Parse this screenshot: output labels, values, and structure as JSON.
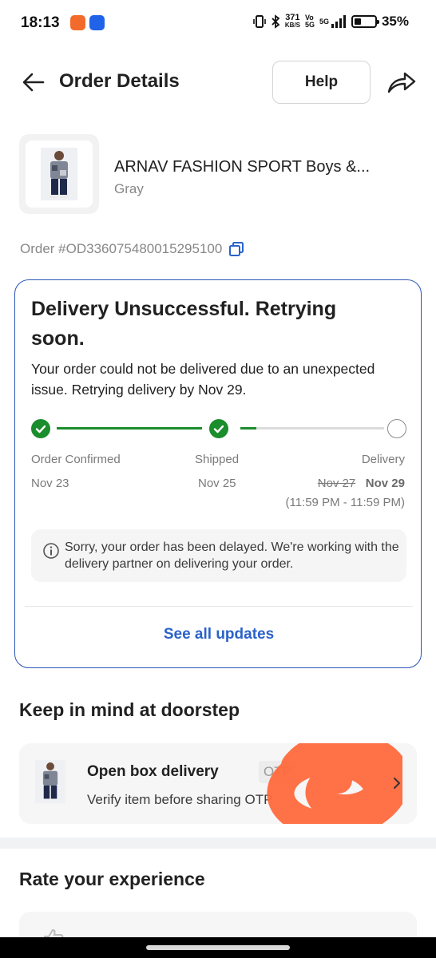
{
  "status_bar": {
    "time": "18:13",
    "net_speed": "371",
    "net_unit": "KB/S",
    "network_label": "5G",
    "battery": "35%"
  },
  "header": {
    "title": "Order Details",
    "help_label": "Help"
  },
  "product": {
    "name": "ARNAV FASHION SPORT Boys &...",
    "variant": "Gray"
  },
  "order": {
    "id": "Order #OD336075480015295100"
  },
  "status_card": {
    "title": "Delivery Unsuccessful. Retrying soon.",
    "description": "Your order could not be delivered due to an unexpected issue. Retrying delivery by Nov 29.",
    "steps": [
      {
        "label": "Order Confirmed",
        "date": "Nov 23",
        "state": "done"
      },
      {
        "label": "Shipped",
        "date": "Nov 25",
        "state": "done"
      },
      {
        "label": "Delivery",
        "old_date": "Nov 27",
        "date": "Nov 29",
        "time": "(11:59 PM - 11:59 PM)",
        "state": "pending"
      }
    ],
    "delay_message": "Sorry, your order has been delayed. We're working with the delivery partner on delivering your order.",
    "see_all_label": "See all updates"
  },
  "doorstep": {
    "section_title": "Keep in mind at doorstep",
    "title": "Open box delivery",
    "tag": "OTP",
    "subtitle": "Verify item before sharing OTP"
  },
  "rate": {
    "section_title": "Rate your experience"
  },
  "colors": {
    "accent_blue": "#2a62c9",
    "success_green": "#1a8d2c",
    "card_border": "#2a55b8",
    "scribble": "#ff6a3d"
  }
}
